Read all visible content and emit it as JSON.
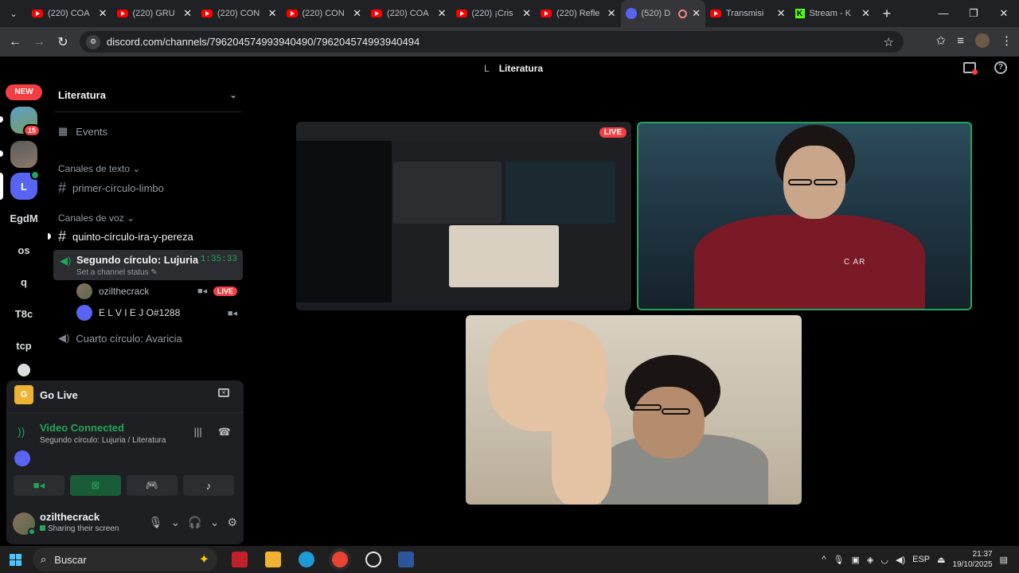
{
  "browser": {
    "tabs": [
      {
        "title": "(220) COA",
        "icon": "youtube-icon",
        "active": false
      },
      {
        "title": "(220) GRU",
        "icon": "youtube-icon",
        "active": false
      },
      {
        "title": "(220) CON",
        "icon": "youtube-icon",
        "active": false
      },
      {
        "title": "(220) CON",
        "icon": "youtube-icon",
        "active": false
      },
      {
        "title": "(220) COA",
        "icon": "youtube-icon",
        "active": false
      },
      {
        "title": "(220) ¡Cris",
        "icon": "youtube-icon",
        "active": false
      },
      {
        "title": "(220) Refle",
        "icon": "youtube-icon",
        "active": false
      },
      {
        "title": "(520) D",
        "icon": "discord-icon",
        "active": true
      },
      {
        "title": "Transmisi",
        "icon": "youtube-icon",
        "active": false
      },
      {
        "title": "Stream - K",
        "icon": "kick-icon",
        "active": false
      }
    ],
    "url": "discord.com/channels/796204574993940490/796204574993940494"
  },
  "discord": {
    "header": {
      "title": "Literatura",
      "letter": "L"
    },
    "rail": {
      "new_label": "NEW",
      "servers": [
        {
          "label": "",
          "badge": "15",
          "kind": "image"
        },
        {
          "label": "",
          "badge": "",
          "kind": "image"
        },
        {
          "label": "L",
          "badge": "",
          "kind": "selected"
        },
        {
          "label": "EgdM",
          "badge": "",
          "kind": "text"
        },
        {
          "label": "os",
          "badge": "",
          "kind": "text"
        },
        {
          "label": "q",
          "badge": "",
          "kind": "text"
        },
        {
          "label": "T8c",
          "badge": "",
          "kind": "text"
        },
        {
          "label": "tcp",
          "badge": "",
          "kind": "text"
        }
      ]
    },
    "sidebar": {
      "server_name": "Literatura",
      "events_label": "Events",
      "text_category": "Canales de texto",
      "text_channel": "primer-círculo-limbo",
      "voice_category": "Canales de voz",
      "voice_channel_unread": "quinto-círculo-ira-y-pereza",
      "active_voice": {
        "name": "Segundo círculo: Lujuria",
        "timer": "1:35:33",
        "status": "Set a channel status"
      },
      "members": [
        {
          "name": "ozilthecrack",
          "live": "LIVE"
        },
        {
          "name": "E L V I E J O#1288",
          "live": ""
        }
      ],
      "other_voice": "Cuarto círculo: Avaricia"
    },
    "panel": {
      "go_live": "Go Live",
      "go_live_icon_letter": "G",
      "voice_status": "Video Connected",
      "voice_detail": "Segundo círculo: Lujuria / Literatura",
      "user_name": "ozilthecrack",
      "user_status": "Sharing their screen"
    },
    "stage": {
      "screen_live": "LIVE",
      "cam_text": "C AR",
      "mini_live": "LIVE"
    }
  },
  "taskbar": {
    "search_placeholder": "Buscar",
    "lang": "ESP",
    "time": "21:37",
    "date": "19/10/2025"
  },
  "colors": {
    "accent_green": "#23a55a",
    "live_red": "#f23f43",
    "blurple": "#5865f2"
  }
}
